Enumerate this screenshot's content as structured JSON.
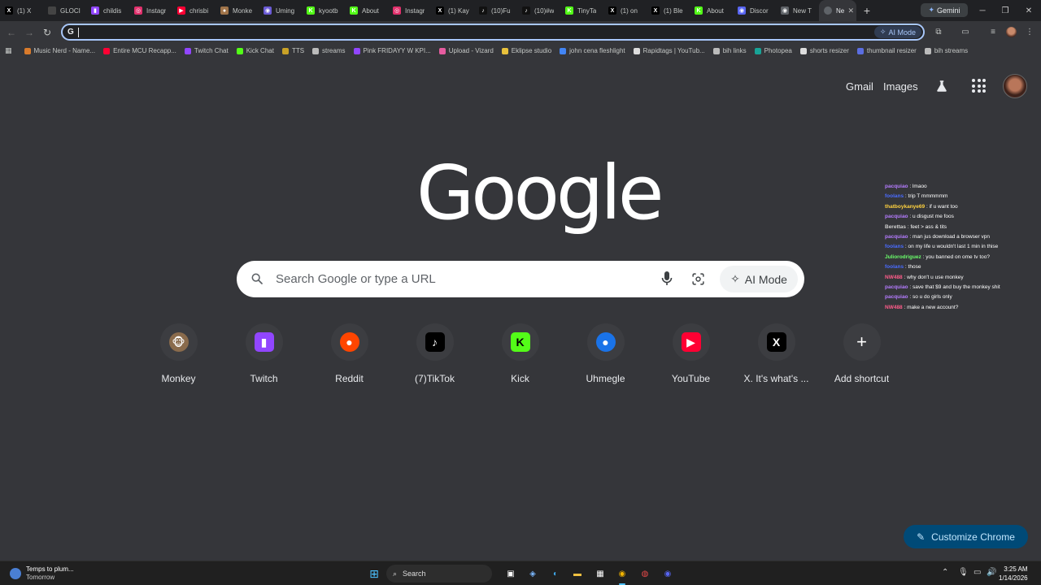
{
  "browser": {
    "tabs": [
      {
        "title": "(1) X",
        "icon": "x-icon",
        "color": "#000000",
        "glyph": "X"
      },
      {
        "title": "GLOCI",
        "icon": "blank-icon",
        "color": "#444444",
        "glyph": ""
      },
      {
        "title": "childis",
        "icon": "twitch-icon",
        "color": "#9146ff",
        "glyph": "▮"
      },
      {
        "title": "Instagr",
        "icon": "instagram-icon",
        "color": "#e1306c",
        "glyph": "◎"
      },
      {
        "title": "chrisbi",
        "icon": "youtube-icon",
        "color": "#ff0033",
        "glyph": "▶"
      },
      {
        "title": "Monke",
        "icon": "monkey-icon",
        "color": "#a0744a",
        "glyph": "●"
      },
      {
        "title": "Uming",
        "icon": "uhmegle-icon",
        "color": "#6b5bd6",
        "glyph": "◉"
      },
      {
        "title": "kyootb",
        "icon": "kick-icon",
        "color": "#53fc18",
        "glyph": "K"
      },
      {
        "title": "About",
        "icon": "kick-icon",
        "color": "#53fc18",
        "glyph": "K"
      },
      {
        "title": "Instagr",
        "icon": "instagram-icon",
        "color": "#e1306c",
        "glyph": "◎"
      },
      {
        "title": "(1) Kay",
        "icon": "x-icon",
        "color": "#000000",
        "glyph": "X"
      },
      {
        "title": "(10)Fu",
        "icon": "tiktok-icon",
        "color": "#111111",
        "glyph": "♪"
      },
      {
        "title": "(10)#w",
        "icon": "tiktok-icon",
        "color": "#111111",
        "glyph": "♪"
      },
      {
        "title": "TinyTa",
        "icon": "kick-icon",
        "color": "#53fc18",
        "glyph": "K"
      },
      {
        "title": "(1) on",
        "icon": "x-icon",
        "color": "#000000",
        "glyph": "X"
      },
      {
        "title": "(1) Ble",
        "icon": "x-icon",
        "color": "#000000",
        "glyph": "X"
      },
      {
        "title": "About",
        "icon": "kick-icon",
        "color": "#53fc18",
        "glyph": "K"
      },
      {
        "title": "Discor",
        "icon": "discord-icon",
        "color": "#5865f2",
        "glyph": "◉"
      },
      {
        "title": "New T",
        "icon": "chrome-icon",
        "color": "#5f6368",
        "glyph": "◉"
      }
    ],
    "active_tab": {
      "title": "Ne",
      "icon": "chrome-icon"
    },
    "new_tab_symbol": "+",
    "gemini_label": "Gemini",
    "omnibox_value": "",
    "omnibox_ai_label": "AI Mode",
    "bookmarks": [
      {
        "label": "Music Nerd - Name...",
        "icon": "music-nerd-icon",
        "color": "#d97b2c"
      },
      {
        "label": "Entire MCU Recapp...",
        "icon": "youtube-icon",
        "color": "#ff0033"
      },
      {
        "label": "Twitch Chat",
        "icon": "twitch-icon",
        "color": "#9146ff"
      },
      {
        "label": "Kick Chat",
        "icon": "kick-icon",
        "color": "#53fc18"
      },
      {
        "label": "TTS",
        "icon": "tts-icon",
        "color": "#c9a227"
      },
      {
        "label": "streams",
        "icon": "streams-icon",
        "color": "#bbbbbb"
      },
      {
        "label": "Pink FRIDAYY W KPI...",
        "icon": "twitch-icon",
        "color": "#9146ff"
      },
      {
        "label": "Upload - Vizard",
        "icon": "vizard-icon",
        "color": "#e65ca0"
      },
      {
        "label": "Eklipse studio",
        "icon": "eklipse-icon",
        "color": "#e8c13c"
      },
      {
        "label": "john cena fleshlight",
        "icon": "search-result-icon",
        "color": "#4285f4"
      },
      {
        "label": "Rapidtags | YouTub...",
        "icon": "rapidtags-icon",
        "color": "#dddddd"
      },
      {
        "label": "bih links",
        "icon": "globe-icon",
        "color": "#bbbbbb"
      },
      {
        "label": "Photopea",
        "icon": "photopea-icon",
        "color": "#18a497"
      },
      {
        "label": "shorts resizer",
        "icon": "shorts-icon",
        "color": "#dddddd"
      },
      {
        "label": "thumbnail resizer",
        "icon": "resizer-icon",
        "color": "#5b6ee1"
      },
      {
        "label": "bih streams",
        "icon": "folder-icon",
        "color": "#bbbbbb"
      }
    ]
  },
  "page": {
    "header": {
      "gmail": "Gmail",
      "images": "Images"
    },
    "logo": "Google",
    "search": {
      "placeholder": "Search Google or type a URL",
      "ai_mode": "AI Mode"
    },
    "shortcuts": [
      {
        "label": "Monkey",
        "icon": "monkey-icon",
        "color": "#8a6b4c",
        "glyph": "🐵"
      },
      {
        "label": "Twitch",
        "icon": "twitch-icon",
        "color": "#9146ff",
        "glyph": "▮"
      },
      {
        "label": "Reddit",
        "icon": "reddit-icon",
        "color": "#ff4500",
        "glyph": "●"
      },
      {
        "label": "(7)TikTok",
        "icon": "tiktok-icon",
        "color": "#000000",
        "glyph": "♪"
      },
      {
        "label": "Kick",
        "icon": "kick-icon",
        "color": "#53fc18",
        "glyph": "K"
      },
      {
        "label": "Uhmegle",
        "icon": "uhmegle-icon",
        "color": "#1a73e8",
        "glyph": "●"
      },
      {
        "label": "YouTube",
        "icon": "youtube-icon",
        "color": "#ff0033",
        "glyph": "▶"
      },
      {
        "label": "X. It's what's ...",
        "icon": "x-icon",
        "color": "#000000",
        "glyph": "X"
      },
      {
        "label": "Add shortcut",
        "icon": "plus-icon",
        "color": "#3c3d41",
        "glyph": "+"
      }
    ],
    "customize_label": "Customize Chrome"
  },
  "chat": [
    {
      "user": "pacquiao",
      "color": "#b57cff",
      "text": "lmaoo"
    },
    {
      "user": "foolans",
      "color": "#4a6cff",
      "text": "trip T mmmmmm"
    },
    {
      "user": "thatboykanye69",
      "color": "#ffd23f",
      "text": "if u want too"
    },
    {
      "user": "pacquiao",
      "color": "#b57cff",
      "text": "u disgust me foos"
    },
    {
      "user": "Berettas",
      "color": "#d0d0d0",
      "text": "feet > ass & tits"
    },
    {
      "user": "pacquiao",
      "color": "#b57cff",
      "text": "man jus download a browser vpn"
    },
    {
      "user": "foolans",
      "color": "#4a6cff",
      "text": "on my life u wouldn't last 1 min in thise"
    },
    {
      "user": "Juliorodriguez",
      "color": "#6bff6b",
      "text": "you banned on ome tv too?"
    },
    {
      "user": "foolans",
      "color": "#4a6cff",
      "text": "those"
    },
    {
      "user": "NW488",
      "color": "#ff5c8a",
      "text": "why don't u use monkey"
    },
    {
      "user": "pacquiao",
      "color": "#b57cff",
      "text": "save that $9 and buy the monkey shit"
    },
    {
      "user": "pacquiao",
      "color": "#b57cff",
      "text": "so u do girls only"
    },
    {
      "user": "NW488",
      "color": "#ff5c8a",
      "text": "make a new account?"
    }
  ],
  "taskbar": {
    "weather_title": "Temps to plum...",
    "weather_sub": "Tomorrow",
    "search_label": "Search",
    "time": "3:25 AM",
    "date": "1/14/2026"
  }
}
